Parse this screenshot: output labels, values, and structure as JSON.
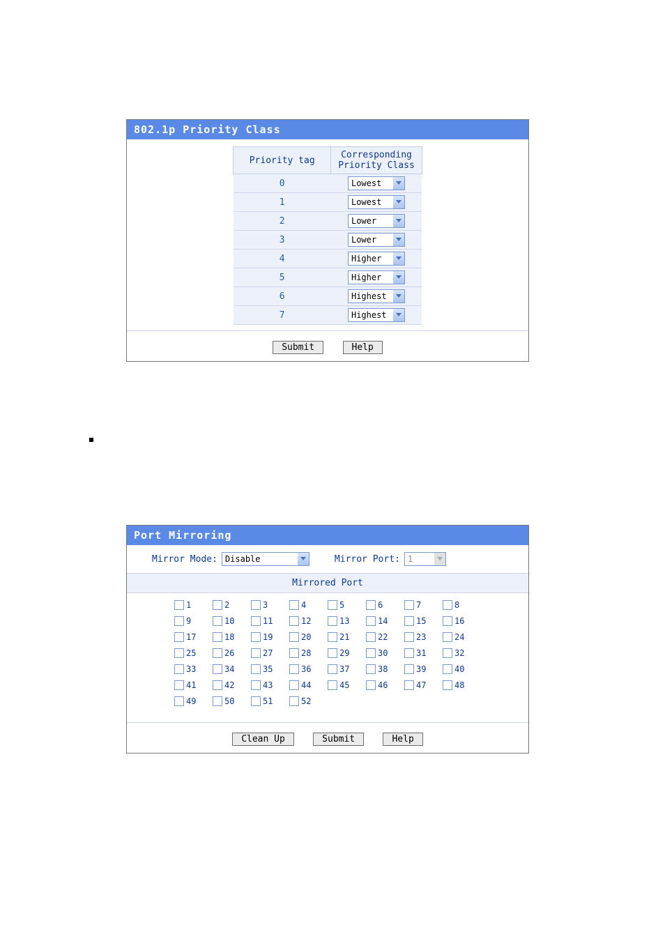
{
  "priority_panel": {
    "title": "802.1p Priority Class",
    "col1": "Priority tag",
    "col2": "Corresponding\nPriority Class",
    "rows": [
      {
        "tag": "0",
        "cls": "Lowest"
      },
      {
        "tag": "1",
        "cls": "Lowest"
      },
      {
        "tag": "2",
        "cls": "Lower"
      },
      {
        "tag": "3",
        "cls": "Lower"
      },
      {
        "tag": "4",
        "cls": "Higher"
      },
      {
        "tag": "5",
        "cls": "Higher"
      },
      {
        "tag": "6",
        "cls": "Highest"
      },
      {
        "tag": "7",
        "cls": "Highest"
      }
    ],
    "submit": "Submit",
    "help": "Help"
  },
  "mirror_panel": {
    "title": "Port Mirroring",
    "mode_label": "Mirror Mode:",
    "mode_value": "Disable",
    "port_label": "Mirror Port:",
    "port_value": "1",
    "mirrored_port_title": "Mirrored Port",
    "ports": [
      "1",
      "2",
      "3",
      "4",
      "5",
      "6",
      "7",
      "8",
      "9",
      "10",
      "11",
      "12",
      "13",
      "14",
      "15",
      "16",
      "17",
      "18",
      "19",
      "20",
      "21",
      "22",
      "23",
      "24",
      "25",
      "26",
      "27",
      "28",
      "29",
      "30",
      "31",
      "32",
      "33",
      "34",
      "35",
      "36",
      "37",
      "38",
      "39",
      "40",
      "41",
      "42",
      "43",
      "44",
      "45",
      "46",
      "47",
      "48",
      "49",
      "50",
      "51",
      "52"
    ],
    "cleanup": "Clean Up",
    "submit": "Submit",
    "help": "Help"
  }
}
